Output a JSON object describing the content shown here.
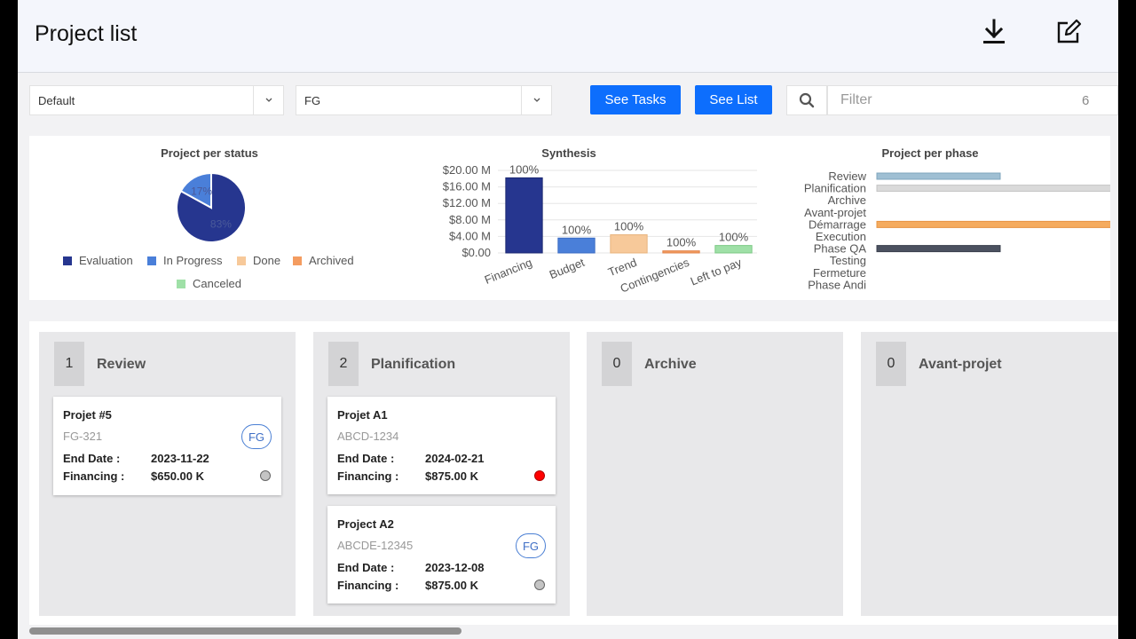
{
  "header": {
    "title": "Project list",
    "download_icon": "download-icon",
    "edit_icon": "edit-icon"
  },
  "toolbar": {
    "select_view": {
      "value": "Default"
    },
    "select_group": {
      "value": "FG"
    },
    "see_tasks_label": "See Tasks",
    "see_list_label": "See List",
    "filter": {
      "placeholder": "Filter",
      "count": "6"
    }
  },
  "colors": {
    "evaluation": "#26368f",
    "in_progress": "#4a7fd9",
    "done": "#f7c99a",
    "archived": "#f49c60",
    "canceled": "#9fe0a7",
    "accent": "#0d6efd"
  },
  "chart_data": [
    {
      "type": "pie",
      "title": "Project per status",
      "slices": [
        {
          "name": "Evaluation",
          "value": 83,
          "label": "83%"
        },
        {
          "name": "In Progress",
          "value": 17,
          "label": "17%"
        },
        {
          "name": "Done",
          "value": 0
        },
        {
          "name": "Archived",
          "value": 0
        },
        {
          "name": "Canceled",
          "value": 0
        }
      ],
      "legend_position": "bottom"
    },
    {
      "type": "bar",
      "title": "Synthesis",
      "categories": [
        "Financing",
        "Budget",
        "Trend",
        "Contingencies",
        "Left to pay"
      ],
      "values": [
        18.2,
        3.6,
        4.4,
        0.5,
        1.8
      ],
      "labels": [
        "100%",
        "100%",
        "100%",
        "100%",
        "100%"
      ],
      "ylim": [
        0,
        20
      ],
      "yticks": [
        "$0.00",
        "$4.00 M",
        "$8.00 M",
        "$12.00 M",
        "$16.00 M",
        "$20.00 M"
      ],
      "grid": true
    },
    {
      "type": "bar",
      "orientation": "horizontal",
      "title": "Project per phase",
      "categories": [
        "Review",
        "Planification",
        "Archive",
        "Avant-projet",
        "Démarrage",
        "Execution",
        "Phase QA",
        "Testing",
        "Fermeture",
        "Phase Andi"
      ],
      "values": [
        1,
        2,
        0,
        0,
        2,
        0,
        1,
        0,
        0,
        0
      ],
      "xlim": [
        0,
        2
      ]
    }
  ],
  "columns": [
    {
      "count": "1",
      "title": "Review",
      "cards": [
        {
          "name": "Projet #5",
          "code": "FG-321",
          "end_label": "End Date :",
          "end_date": "2023-11-22",
          "fin_label": "Financing :",
          "financing": "$650.00 K",
          "badge": "FG",
          "status_color": "#c4c4c4"
        }
      ]
    },
    {
      "count": "2",
      "title": "Planification",
      "cards": [
        {
          "name": "Projet A1",
          "code": "ABCD-1234",
          "end_label": "End Date :",
          "end_date": "2024-02-21",
          "fin_label": "Financing :",
          "financing": "$875.00 K",
          "status_color": "#ff0000"
        },
        {
          "name": "Project A2",
          "code": "ABCDE-12345",
          "end_label": "End Date :",
          "end_date": "2023-12-08",
          "fin_label": "Financing :",
          "financing": "$875.00 K",
          "badge": "FG",
          "status_color": "#c4c4c4"
        }
      ]
    },
    {
      "count": "0",
      "title": "Archive",
      "cards": []
    },
    {
      "count": "0",
      "title": "Avant-projet",
      "cards": []
    }
  ]
}
